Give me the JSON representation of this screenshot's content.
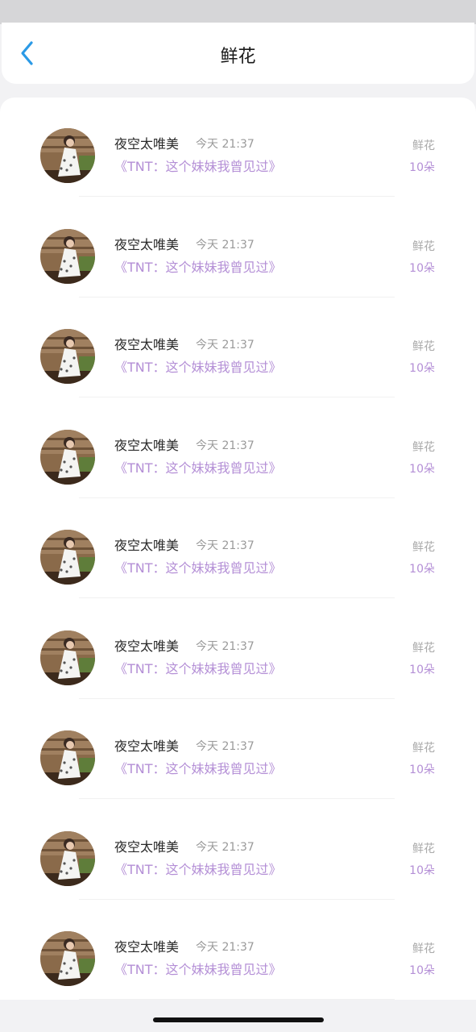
{
  "header": {
    "title": "鲜花",
    "back_icon": "chevron-left-icon",
    "accent": "#2b9ae6"
  },
  "colors": {
    "song": "#b48fd6",
    "gift_count": "#b48fd6",
    "muted": "#9a9a9a"
  },
  "records": [
    {
      "name": "夜空太唯美",
      "time": "今天 21:37",
      "song": "《TNT：这个妹妹我曾见过》",
      "gift": "鲜花",
      "count": "10朵"
    },
    {
      "name": "夜空太唯美",
      "time": "今天 21:37",
      "song": "《TNT：这个妹妹我曾见过》",
      "gift": "鲜花",
      "count": "10朵"
    },
    {
      "name": "夜空太唯美",
      "time": "今天 21:37",
      "song": "《TNT：这个妹妹我曾见过》",
      "gift": "鲜花",
      "count": "10朵"
    },
    {
      "name": "夜空太唯美",
      "time": "今天 21:37",
      "song": "《TNT：这个妹妹我曾见过》",
      "gift": "鲜花",
      "count": "10朵"
    },
    {
      "name": "夜空太唯美",
      "time": "今天 21:37",
      "song": "《TNT：这个妹妹我曾见过》",
      "gift": "鲜花",
      "count": "10朵"
    },
    {
      "name": "夜空太唯美",
      "time": "今天 21:37",
      "song": "《TNT：这个妹妹我曾见过》",
      "gift": "鲜花",
      "count": "10朵"
    },
    {
      "name": "夜空太唯美",
      "time": "今天 21:37",
      "song": "《TNT：这个妹妹我曾见过》",
      "gift": "鲜花",
      "count": "10朵"
    },
    {
      "name": "夜空太唯美",
      "time": "今天 21:37",
      "song": "《TNT：这个妹妹我曾见过》",
      "gift": "鲜花",
      "count": "10朵"
    },
    {
      "name": "夜空太唯美",
      "time": "今天 21:37",
      "song": "《TNT：这个妹妹我曾见过》",
      "gift": "鲜花",
      "count": "10朵"
    }
  ]
}
